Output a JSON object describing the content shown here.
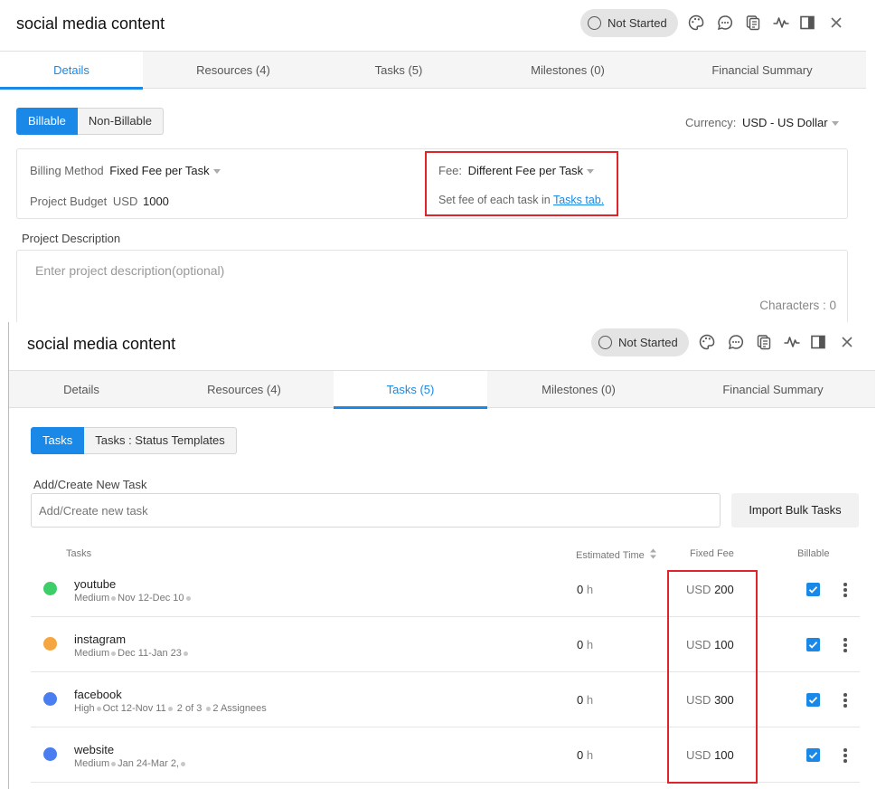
{
  "top_panel": {
    "title": "social media content",
    "status_label": "Not Started",
    "tabs": [
      "Details",
      "Resources (4)",
      "Tasks (5)",
      "Milestones (0)",
      "Financial Summary"
    ],
    "active_tab": "Details",
    "billing_toggle": {
      "on": "Billable",
      "off": "Non-Billable"
    },
    "currency_label": "Currency:",
    "currency_value": "USD - US Dollar",
    "billing_method_label": "Billing Method",
    "billing_method_value": "Fixed Fee per Task",
    "project_budget_label": "Project Budget",
    "project_budget_currency": "USD",
    "project_budget_value": "1000",
    "fee_label": "Fee:",
    "fee_value": "Different Fee per Task",
    "fee_hint_text": "Set fee of each task in",
    "fee_hint_link": "Tasks tab.",
    "description_label": "Project Description",
    "description_placeholder": "Enter project description(optional)",
    "characters_label": "Characters : 0"
  },
  "bottom_panel": {
    "title": "social media content",
    "status_label": "Not Started",
    "tabs": [
      "Details",
      "Resources (4)",
      "Tasks (5)",
      "Milestones (0)",
      "Financial Summary"
    ],
    "active_tab": "Tasks (5)",
    "task_toggle": {
      "on": "Tasks",
      "off": "Tasks : Status Templates"
    },
    "new_task_label": "Add/Create New Task",
    "new_task_placeholder": "Add/Create new task",
    "import_button": "Import Bulk Tasks",
    "columns": {
      "tasks": "Tasks",
      "estimated_time": "Estimated Time",
      "fixed_fee": "Fixed Fee",
      "billable": "Billable"
    },
    "tasks": [
      {
        "name": "youtube",
        "priority": "Medium",
        "dates": "Nov 12-Dec 10",
        "extra": "",
        "assignees": "",
        "time": "0",
        "time_unit": "h",
        "currency": "USD",
        "fee": "200",
        "billable": true,
        "color": "#3dce6a"
      },
      {
        "name": "instagram",
        "priority": "Medium",
        "dates": "Dec 11-Jan 23",
        "extra": "",
        "assignees": "",
        "time": "0",
        "time_unit": "h",
        "currency": "USD",
        "fee": "100",
        "billable": true,
        "color": "#f5a641"
      },
      {
        "name": "facebook",
        "priority": "High",
        "dates": "Oct 12-Nov 11",
        "extra": "2 of 3",
        "assignees": "2 Assignees",
        "time": "0",
        "time_unit": "h",
        "currency": "USD",
        "fee": "300",
        "billable": true,
        "color": "#4a7ef0"
      },
      {
        "name": "website",
        "priority": "Medium",
        "dates": "Jan 24-Mar 2,",
        "extra": "",
        "assignees": "",
        "time": "0",
        "time_unit": "h",
        "currency": "USD",
        "fee": "100",
        "billable": true,
        "color": "#4a7ef0"
      }
    ]
  },
  "colors": {
    "accent": "#1a88e6",
    "highlight": "#e0242c"
  },
  "icons": [
    "palette-icon",
    "chat-icon",
    "copy-icon",
    "activity-icon",
    "split-view-icon",
    "close-icon"
  ]
}
